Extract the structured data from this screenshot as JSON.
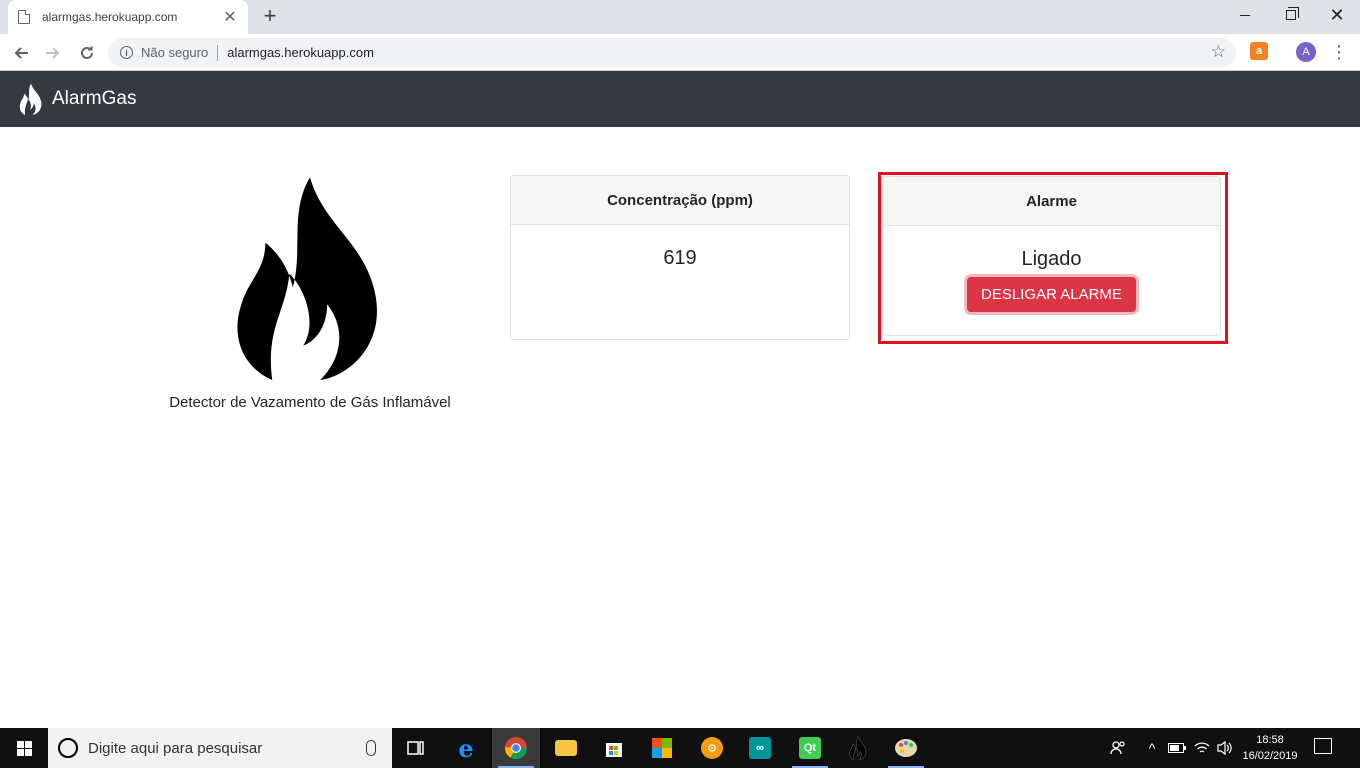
{
  "browser": {
    "tab_title": "alarmgas.herokuapp.com",
    "tab_close": "✕",
    "new_tab": "+",
    "security_label": "Não seguro",
    "url": "alarmgas.herokuapp.com",
    "profile_initial": "A",
    "extension_label": "a",
    "menu_glyph": "⋮"
  },
  "navbar": {
    "brand": "AlarmGas"
  },
  "logo": {
    "caption": "Detector de Vazamento de Gás Inflamável"
  },
  "cards": {
    "concentration": {
      "header": "Concentração (ppm)",
      "value": "619"
    },
    "alarm": {
      "header": "Alarme",
      "status": "Ligado",
      "button_label": "DESLIGAR ALARME"
    }
  },
  "colors": {
    "navbar_bg": "#343a40",
    "danger": "#dc3545",
    "highlight_border": "#e0101f"
  },
  "taskbar": {
    "search_placeholder": "Digite aqui para pesquisar",
    "time": "18:58",
    "date": "16/02/2019",
    "apps": [
      "task-view",
      "edge",
      "chrome",
      "file-explorer",
      "store",
      "office",
      "settings",
      "arduino",
      "qt-creator",
      "alarmgas-flame",
      "paint"
    ]
  }
}
